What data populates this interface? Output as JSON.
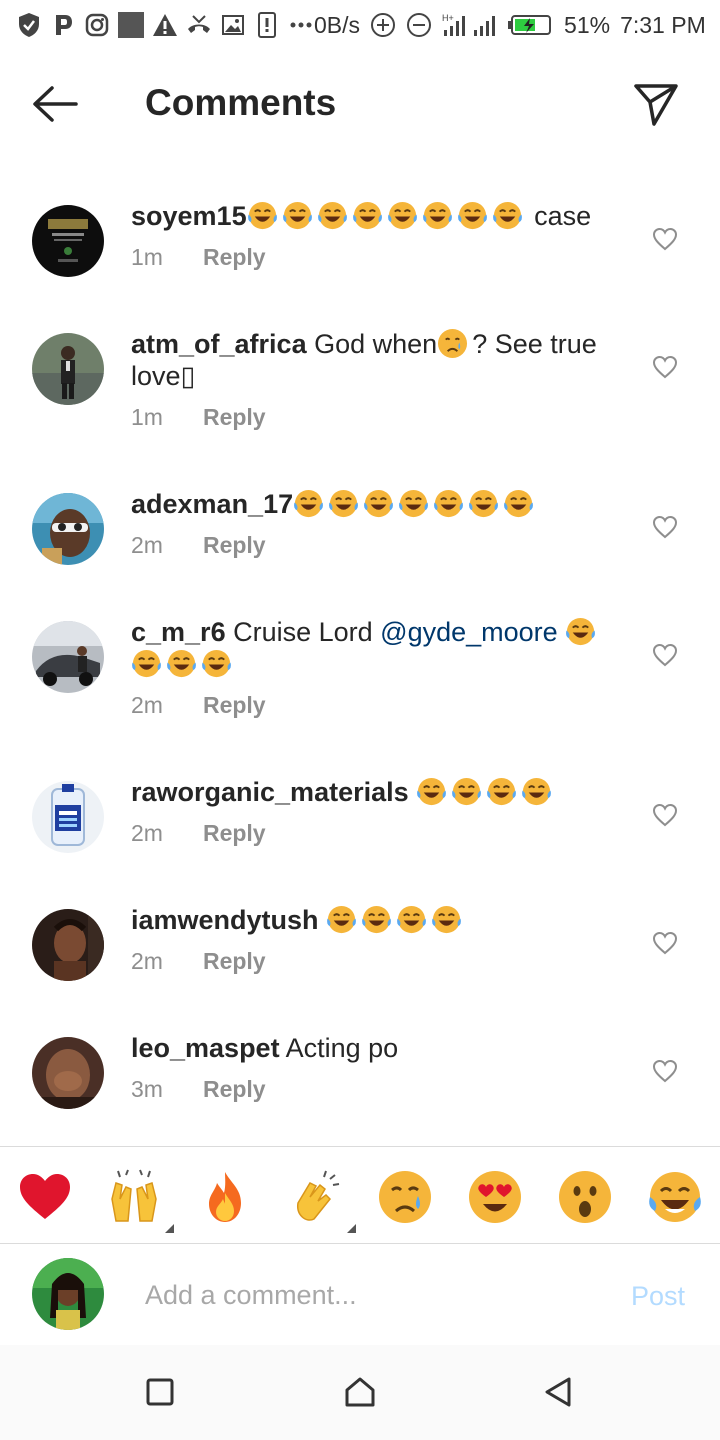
{
  "status_bar": {
    "network_speed": "0B/s",
    "battery": "51%",
    "time": "7:31 PM"
  },
  "header": {
    "title": "Comments"
  },
  "comments": [
    {
      "username": "soyem15",
      "text": "",
      "emoji_count": 8,
      "suffix": " case",
      "time": "1m",
      "reply": "Reply"
    },
    {
      "username": "atm_of_africa",
      "text": " God when",
      "suffix": "? See true love▯",
      "time": "1m",
      "reply": "Reply"
    },
    {
      "username": "adexman_17",
      "text": "",
      "emoji_count": 7,
      "time": "2m",
      "reply": "Reply"
    },
    {
      "username": "c_m_r6",
      "text": " Cruise Lord ",
      "mention": "@gyde_moore",
      "emoji_count": 4,
      "time": "2m",
      "reply": "Reply"
    },
    {
      "username": "raworganic_materials",
      "text": "",
      "emoji_count": 4,
      "time": "2m",
      "reply": "Reply"
    },
    {
      "username": "iamwendytush",
      "text": "",
      "emoji_count": 4,
      "time": "2m",
      "reply": "Reply"
    },
    {
      "username": "leo_maspet",
      "text": " Acting po",
      "time": "3m",
      "reply": "Reply"
    }
  ],
  "reactions": [
    "heart",
    "raising-hands",
    "fire",
    "clapping-hands",
    "crying-face",
    "heart-eyes",
    "surprised-face",
    "tears-of-joy"
  ],
  "composer": {
    "placeholder": "Add a comment...",
    "post_label": "Post"
  },
  "colors": {
    "accent_post_disabled": "#b3dbff",
    "mention": "#00376b",
    "meta": "#8e8e8e"
  }
}
